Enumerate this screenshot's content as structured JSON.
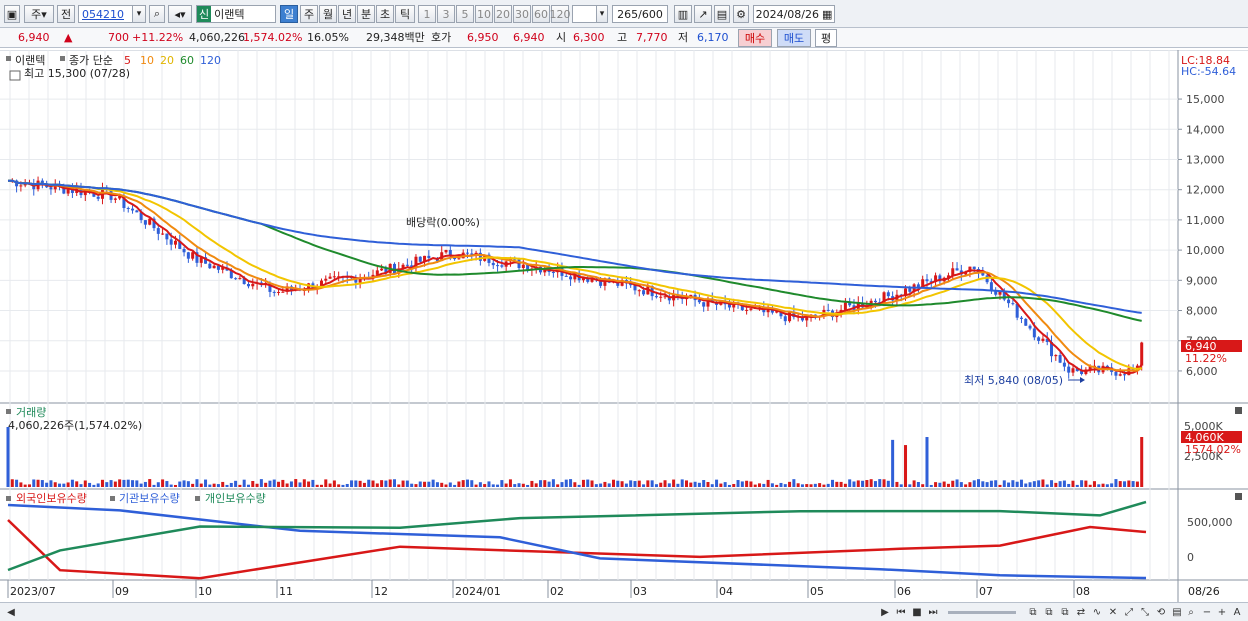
{
  "toolbar": {
    "market": "주",
    "prev_label": "전",
    "code": "054210",
    "badge": "신",
    "name": "이랜텍",
    "periods": [
      "일",
      "주",
      "월",
      "년",
      "분",
      "초",
      "틱"
    ],
    "active_period": "일",
    "minute_options": [
      "1",
      "3",
      "5",
      "10",
      "20",
      "30",
      "60",
      "120"
    ],
    "count": "265",
    "count_max": "/600",
    "date": "2024/08/26"
  },
  "quote": {
    "price": "6,940",
    "change": "700",
    "change_pct": "+11.22%",
    "volume": "4,060,226",
    "volume_ratio": "1,574.02%",
    "turnover": "16.05%",
    "amount": "29,348백만",
    "hoga_label": "호가",
    "ask": "6,950",
    "bid": "6,940",
    "open_label": "시",
    "open": "6,300",
    "high_label": "고",
    "high": "7,770",
    "low_label": "저",
    "low": "6,170",
    "buy_label": "매수",
    "sell_label": "매도",
    "eval_label": "평"
  },
  "price_panel": {
    "legend_name": "이랜텍",
    "legend_ma": "종가 단순",
    "ma_periods": [
      {
        "label": "5",
        "color": "#d81818"
      },
      {
        "label": "10",
        "color": "#f08a10"
      },
      {
        "label": "20",
        "color": "#f2c500"
      },
      {
        "label": "60",
        "color": "#1f8a2c"
      },
      {
        "label": "120",
        "color": "#2f5fd8"
      }
    ],
    "max_label": "최고 15,300 (07/28)",
    "min_label": "최저 5,840 (08/05)",
    "dividend_label": "배당락(0.00%)",
    "lc_label": "LC:18.84",
    "hc_label": "HC:-54.64",
    "y_ticks": [
      "15,000",
      "14,000",
      "13,000",
      "12,000",
      "11,000",
      "10,000",
      "9,000",
      "8,000",
      "7,000",
      "6,000"
    ],
    "price_tag": "6,940",
    "pct_tag": "11.22%"
  },
  "volume_panel": {
    "title": "거래량",
    "value_label": "4,060,226주(1,574.02%)",
    "y_ticks": [
      "5,000K",
      "2,500K"
    ],
    "tag": "4,060K",
    "pct_tag": "1574.02%"
  },
  "holding_panel": {
    "series_labels": [
      "외국인보유수량",
      "기관보유수량",
      "개인보유수량"
    ],
    "series_colors": [
      "#d81818",
      "#2f5fd8",
      "#1f8a5a"
    ],
    "y_ticks": [
      "500,000",
      "0"
    ]
  },
  "x_axis": [
    "2023/07",
    "09",
    "10",
    "11",
    "12",
    "2024/01",
    "02",
    "03",
    "04",
    "05",
    "06",
    "07",
    "08",
    "08/26"
  ],
  "chart_data": {
    "type": "line",
    "x": [
      "2023/07",
      "09",
      "10",
      "11",
      "12",
      "2024/01",
      "02",
      "03",
      "04",
      "05",
      "06",
      "07",
      "08"
    ],
    "series": [
      {
        "values": [
          12300,
          11800,
          9700,
          8600,
          9200,
          9900,
          9400,
          8800,
          8200,
          7700,
          8500,
          9500,
          6000
        ]
      }
    ],
    "ylim": [
      5700,
      15300
    ],
    "grid": true
  }
}
